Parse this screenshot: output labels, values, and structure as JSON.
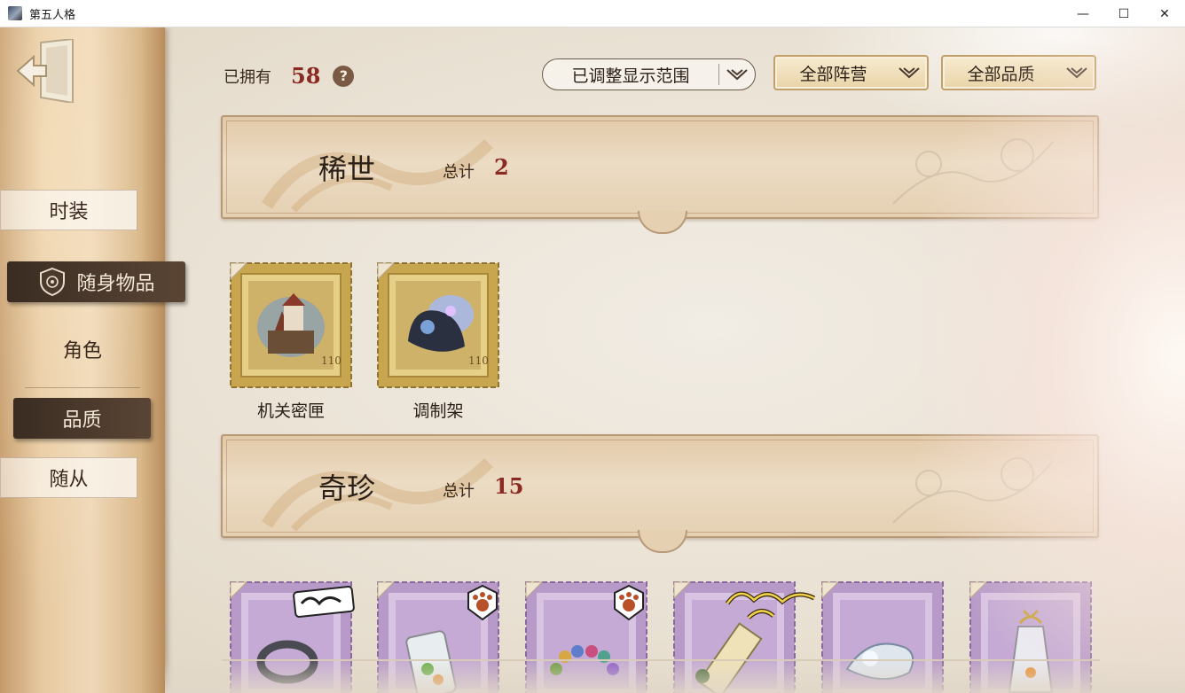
{
  "window": {
    "title": "第五人格",
    "controls": {
      "minimize": "—",
      "maximize": "☐",
      "close": "✕"
    }
  },
  "sidebar": {
    "back_icon": "exit-door-icon",
    "items": [
      {
        "label": "时装",
        "state": "normal"
      },
      {
        "label": "随身物品",
        "state": "selected",
        "icon": "shield-emblem-icon"
      },
      {
        "label": "角色",
        "state": "normal"
      },
      {
        "label": "品质",
        "state": "selected-sub"
      },
      {
        "label": "随从",
        "state": "normal"
      }
    ]
  },
  "toolbar": {
    "owned_label": "已拥有",
    "owned_count": "58",
    "help": "?",
    "filters": [
      {
        "label": "已调整显示范围",
        "style": "outline"
      },
      {
        "label": "全部阵营",
        "style": "gold"
      },
      {
        "label": "全部品质",
        "style": "gold"
      }
    ]
  },
  "categories": [
    {
      "name": "稀世",
      "total_label": "总计",
      "total": "2",
      "frame_color": "gold",
      "items": [
        {
          "label": "机关密匣",
          "art": "castle-chest"
        },
        {
          "label": "调制架",
          "art": "glowing-gadget"
        }
      ]
    },
    {
      "name": "奇珍",
      "total_label": "总计",
      "total": "15",
      "frame_color": "purple",
      "items": [
        {
          "label": "",
          "art": "stone-ring",
          "badge": "vinyl-label"
        },
        {
          "label": "",
          "art": "jar-of-sweets",
          "badge": "paw-badge"
        },
        {
          "label": "",
          "art": "bead-bracelet",
          "badge": "paw-badge"
        },
        {
          "label": "",
          "art": "scroll",
          "badge": "script-label"
        },
        {
          "label": "",
          "art": "crystal-fish",
          "badge": ""
        },
        {
          "label": "",
          "art": "bottle-ornament",
          "badge": "bow"
        }
      ]
    }
  ],
  "colors": {
    "accent_red": "#8a2a22",
    "gold_frame": "#c7a64f",
    "purple_frame": "#b89ac8",
    "text_dark": "#2b2018"
  }
}
